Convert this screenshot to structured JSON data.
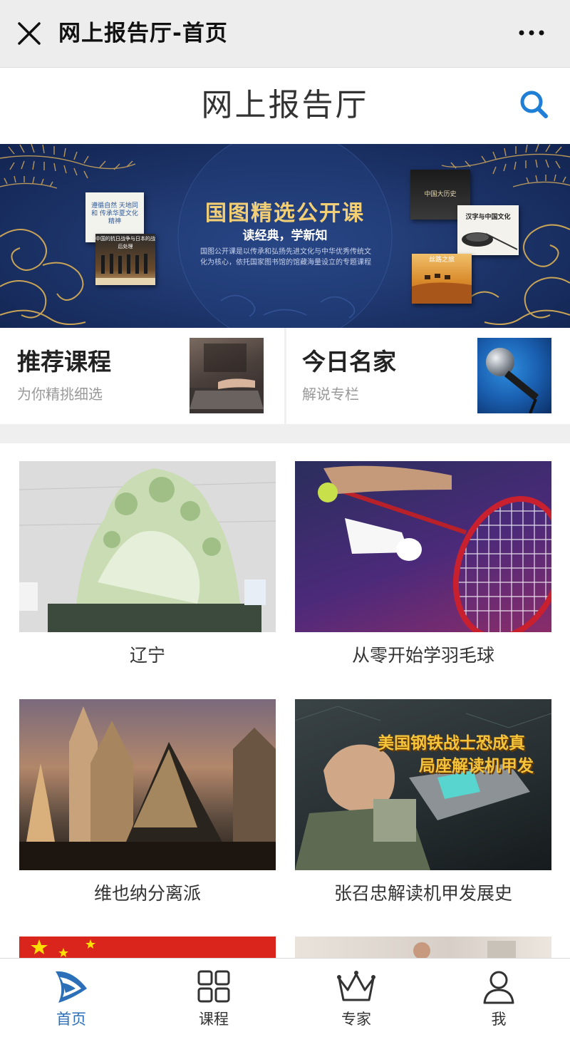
{
  "wechat_bar": {
    "title": "网上报告厅-首页",
    "close_icon": "close-icon",
    "more_icon": "more-dots-icon"
  },
  "header": {
    "title": "网上报告厅",
    "search_icon": "search-icon",
    "accent_color": "#1f7ed6"
  },
  "banner": {
    "title": "国图精选公开课",
    "subtitle": "读经典，学新知",
    "description": "国图公开课是以传承和弘扬先进文化与中华优秀传统文化为核心，依托国家图书馆的馆藏海量设立的专题课程",
    "thumbs": {
      "t1_text": "遵循自然 天地同和 传承华夏文化精神",
      "t2_text": "中国的抗日战争与日本的战后处理",
      "t3_text": "中国大历史",
      "t4_text": "汉字与中国文化",
      "t5_text": "丝路之旅"
    },
    "slide_count": 5,
    "active_slide": 3
  },
  "entries": [
    {
      "title": "推荐课程",
      "subtitle": "为你精挑细选"
    },
    {
      "title": "今日名家",
      "subtitle": "解说专栏"
    }
  ],
  "courses": [
    {
      "label": "辽宁"
    },
    {
      "label": "从零开始学羽毛球"
    },
    {
      "label": "维也纳分离派"
    },
    {
      "label": "张召忠解读机甲发展史",
      "image_text_1": "美国钢铁战士恐成真",
      "image_text_2": "局座解读机甲发"
    }
  ],
  "tabbar": {
    "tabs": [
      {
        "label": "首页",
        "icon": "home-logo-icon",
        "active": true
      },
      {
        "label": "课程",
        "icon": "grid-icon",
        "active": false
      },
      {
        "label": "专家",
        "icon": "crown-icon",
        "active": false
      },
      {
        "label": "我",
        "icon": "user-icon",
        "active": false
      }
    ],
    "active_color": "#2a6fb8"
  }
}
